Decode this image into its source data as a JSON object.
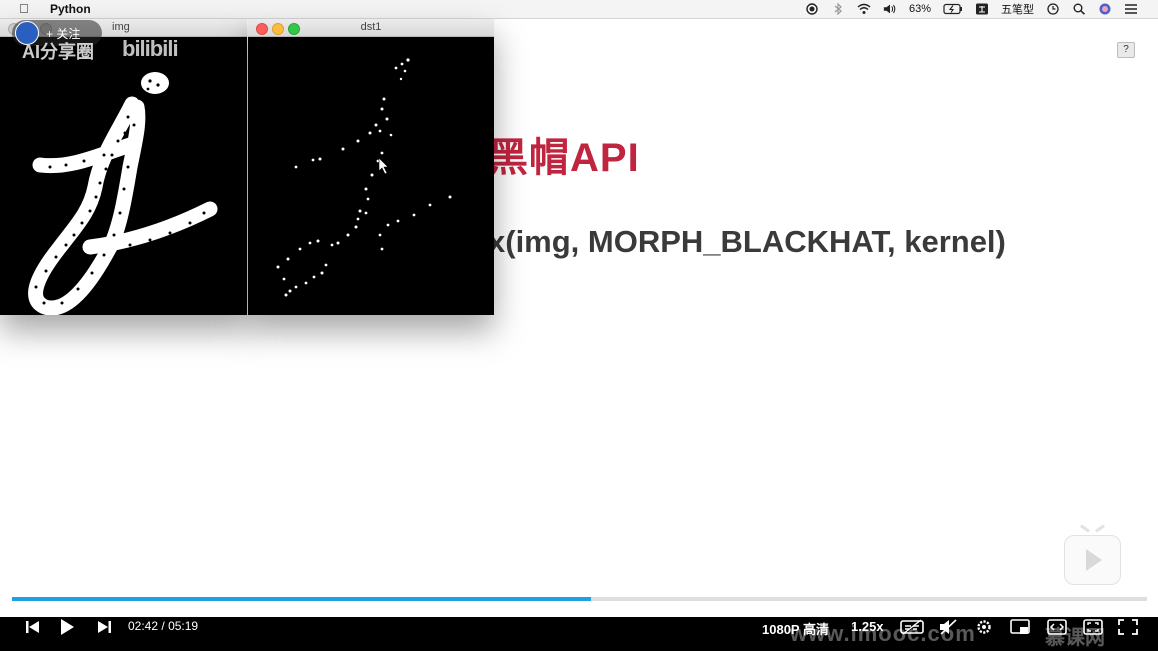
{
  "menubar": {
    "app_name": "Python",
    "battery": "63%",
    "input_method": "五笔型",
    "icon_names": [
      "apple-icon",
      "record-icon",
      "bluetooth-icon",
      "wifi-icon",
      "volume-icon",
      "battery-icon",
      "input-method-icon",
      "clock-icon",
      "search-icon",
      "user-icon",
      "list-icon"
    ]
  },
  "windows": {
    "img_title": "img",
    "dst_title": "dst1"
  },
  "overlay": {
    "follow_label": "+ 关注",
    "watermark": "AI分享圈",
    "bili": "bilibili"
  },
  "slide": {
    "help": "?",
    "title": "黑帽API",
    "code": "x(img, MORPH_BLACKHAT, kernel)"
  },
  "player": {
    "current_time": "02:42",
    "separator": "/",
    "duration": "05:19",
    "quality": "1080P 高清",
    "speed": "1.25x",
    "progress": 0.51,
    "site_watermark": "www.imooc.com",
    "site_watermark_cn": "慕课网",
    "accent": "#1e9fe6"
  },
  "colors": {
    "title": "#c0253f",
    "code": "#3a3a3a"
  }
}
